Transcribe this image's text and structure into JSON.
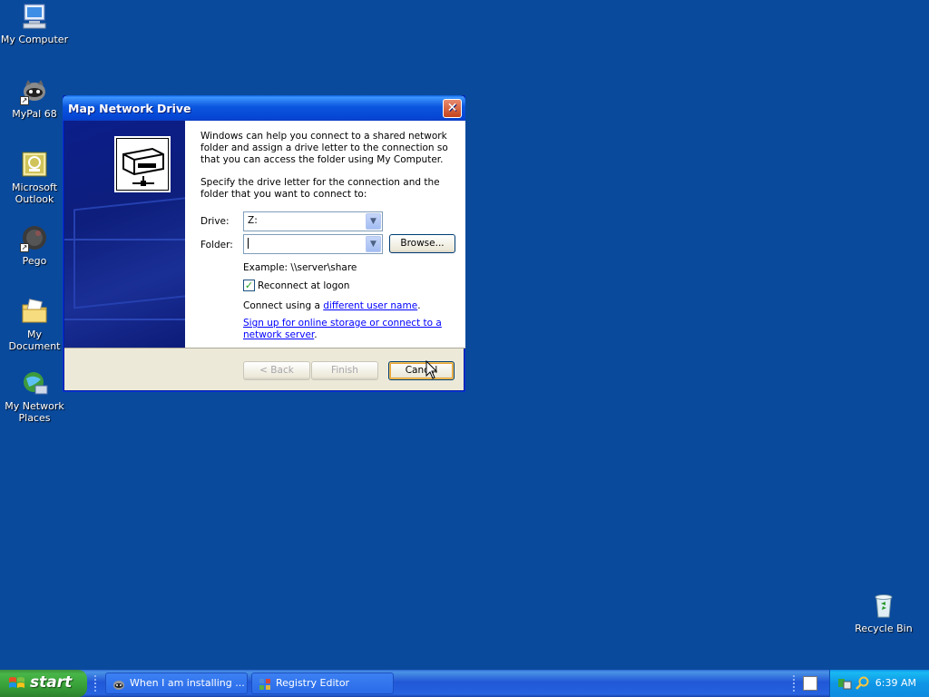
{
  "desktop": {
    "icons": [
      {
        "label": "My Computer",
        "icon": "computer-icon"
      },
      {
        "label": "MyPal 68",
        "icon": "raccoon-icon"
      },
      {
        "label": "Microsoft Outlook",
        "icon": "outlook-icon"
      },
      {
        "label": "Pego",
        "icon": "pego-icon"
      },
      {
        "label": "My Document",
        "icon": "folder-icon"
      },
      {
        "label": "My Network Places",
        "icon": "network-icon"
      },
      {
        "label": "Recycle Bin",
        "icon": "recycle-bin-icon"
      }
    ]
  },
  "dialog": {
    "title": "Map Network Drive",
    "intro": "Windows can help you connect to a shared network folder and assign a drive letter to the connection so that you can access the folder using My Computer.",
    "specify": "Specify the drive letter for the connection and the folder that you want to connect to:",
    "drive_label": "Drive:",
    "drive_value": "Z:",
    "folder_label": "Folder:",
    "folder_value": "",
    "browse_label": "Browse...",
    "example": "Example: \\\\server\\share",
    "reconnect_label": "Reconnect at logon",
    "reconnect_checked": true,
    "connect_using_prefix": "Connect using a ",
    "different_user_link": "different user name",
    "connect_using_suffix": ".",
    "signup_link": "Sign up for online storage or connect to a network server",
    "signup_suffix": ".",
    "back_label": "< Back",
    "finish_label": "Finish",
    "cancel_label": "Cancel"
  },
  "taskbar": {
    "start_label": "start",
    "tasks": [
      {
        "label": "When I am installing ...",
        "icon": "raccoon-icon"
      },
      {
        "label": "Registry Editor",
        "icon": "registry-editor-icon"
      }
    ],
    "clock": "6:39 AM"
  }
}
